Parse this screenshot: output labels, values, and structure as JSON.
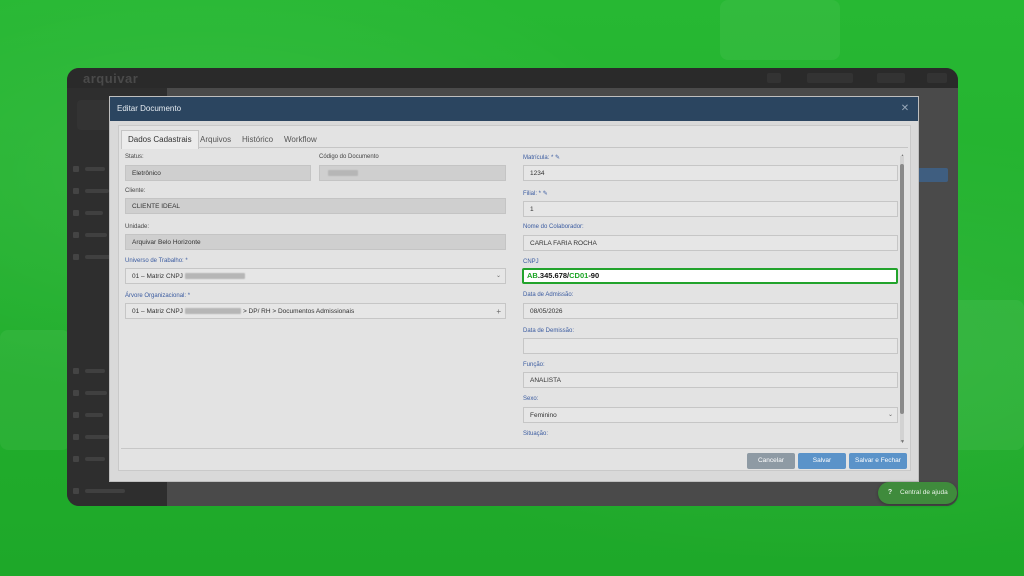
{
  "app": {
    "logo": "arquivar"
  },
  "modal": {
    "title": "Editar Documento",
    "close_icon": "close-icon"
  },
  "tabs": [
    {
      "label": "Dados Cadastrais",
      "active": true
    },
    {
      "label": "Arquivos",
      "active": false
    },
    {
      "label": "Histórico",
      "active": false
    },
    {
      "label": "Workflow",
      "active": false
    }
  ],
  "left": {
    "status": {
      "label": "Status:",
      "value": "Eletrônico"
    },
    "codigo": {
      "label": "Código do Documento"
    },
    "cliente": {
      "label": "Cliente:",
      "value": "CLIENTE IDEAL"
    },
    "unidade": {
      "label": "Unidade:",
      "value": "Arquivar Belo Horizonte"
    },
    "universo": {
      "label": "Universo de Trabalho: *",
      "value_prefix": "01 – Matriz CNPJ"
    },
    "arvore": {
      "label": "Árvore Organizacional: *",
      "value_prefix": "01 – Matriz CNPJ",
      "value_suffix": "> DP/ RH > Documentos Admissionais"
    }
  },
  "right": {
    "matricula": {
      "label": "Matrícula: *",
      "value": "1234"
    },
    "filial": {
      "label": "Filial: *",
      "value": "1"
    },
    "nome": {
      "label": "Nome do Colaborador:",
      "value": "CARLA FARIA ROCHA"
    },
    "cnpj": {
      "label": "CNPJ",
      "part1": "AB",
      "part2": ".345.678/",
      "part3": "CD01",
      "part4": "-90"
    },
    "admissao": {
      "label": "Data de Admissão:",
      "value": "08/05/2026"
    },
    "demissao": {
      "label": "Data de Demissão:",
      "value": ""
    },
    "funcao": {
      "label": "Função:",
      "value": "ANALISTA"
    },
    "sexo": {
      "label": "Sexo:",
      "value": "Feminino"
    },
    "situacao": {
      "label": "Situação:"
    }
  },
  "buttons": {
    "cancel": "Cancelar",
    "save": "Salvar",
    "save_close": "Salvar e Fechar"
  },
  "help": {
    "label": "Central de ajuda",
    "icon": "?"
  },
  "colors": {
    "background_green": "#1fae2a",
    "modal_header": "#2b4560",
    "cnpj_highlight": "#22a32c",
    "button_primary": "#5b93c9",
    "button_cancel": "#8e9aa4"
  }
}
